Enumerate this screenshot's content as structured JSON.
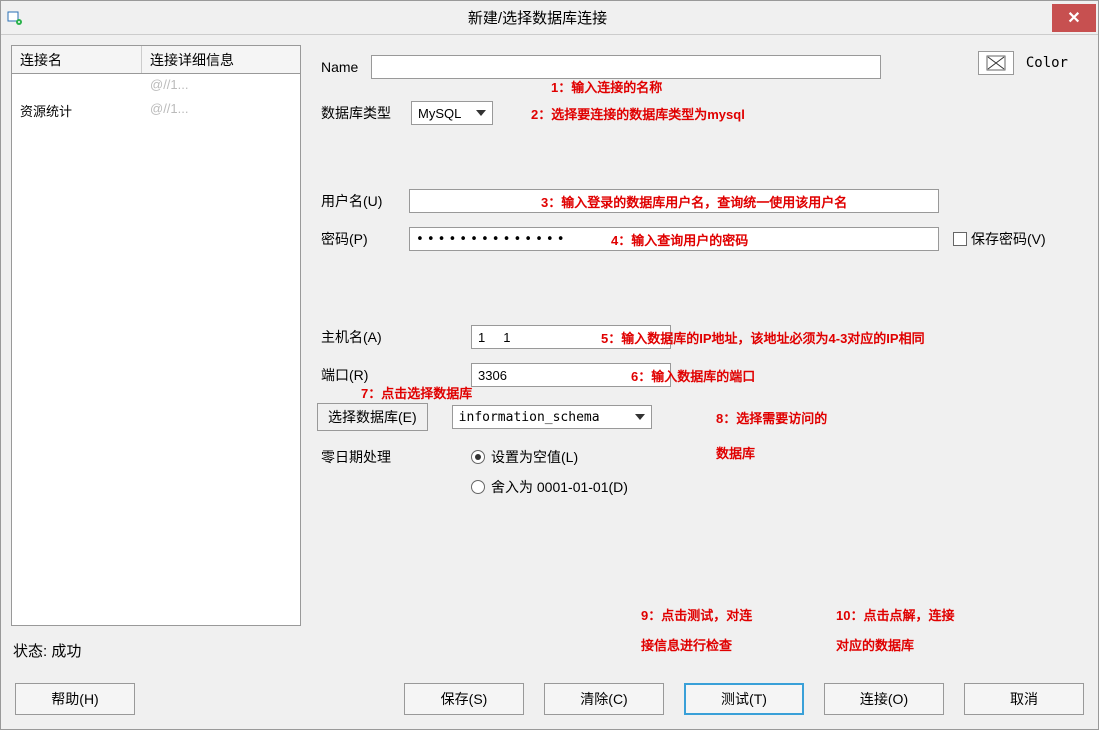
{
  "window": {
    "title": "新建/选择数据库连接"
  },
  "left": {
    "headers": {
      "name": "连接名",
      "details": "连接详细信息"
    },
    "rows": [
      {
        "name": "      ",
        "details": "     @//1..."
      },
      {
        "name": "资源统计",
        "details": "     @//1..."
      }
    ],
    "status_label": "状态:",
    "status_value": "成功"
  },
  "form": {
    "name_label": "Name",
    "name_value": "",
    "color_label": "Color",
    "dbtype_label": "数据库类型",
    "dbtype_value": "MySQL",
    "user_label": "用户名(U)",
    "user_value": "",
    "pass_label": "密码(P)",
    "pass_value": "••••••••••••••",
    "save_pass_label": "保存密码(V)",
    "host_label": "主机名(A)",
    "host_value": "1     1  ",
    "port_label": "端口(R)",
    "port_value": "3306",
    "select_db_btn": "选择数据库(E)",
    "db_value": "information_schema",
    "zerodate_label": "零日期处理",
    "zerodate_null": "设置为空值(L)",
    "zerodate_round": "舍入为 0001-01-01(D)"
  },
  "annotations": {
    "a1": "1：输入连接的名称",
    "a2": "2：选择要连接的数据库类型为mysql",
    "a3": "3：输入登录的数据库用户名，查询统一使用该用户名",
    "a4": "4：输入查询用户的密码",
    "a5": "5：输入数据库的IP地址，该地址必须为4-3对应的IP相同",
    "a6": "6：输入数据库的端口",
    "a7": "7：点击选择数据库",
    "a8a": "8：选择需要访问的",
    "a8b": "数据库",
    "a9a": "9：点击测试，对连",
    "a9b": "接信息进行检查",
    "a10a": "10：点击点解，连接",
    "a10b": "对应的数据库"
  },
  "buttons": {
    "help": "帮助(H)",
    "save": "保存(S)",
    "clear": "清除(C)",
    "test": "测试(T)",
    "connect": "连接(O)",
    "cancel": "取消"
  }
}
